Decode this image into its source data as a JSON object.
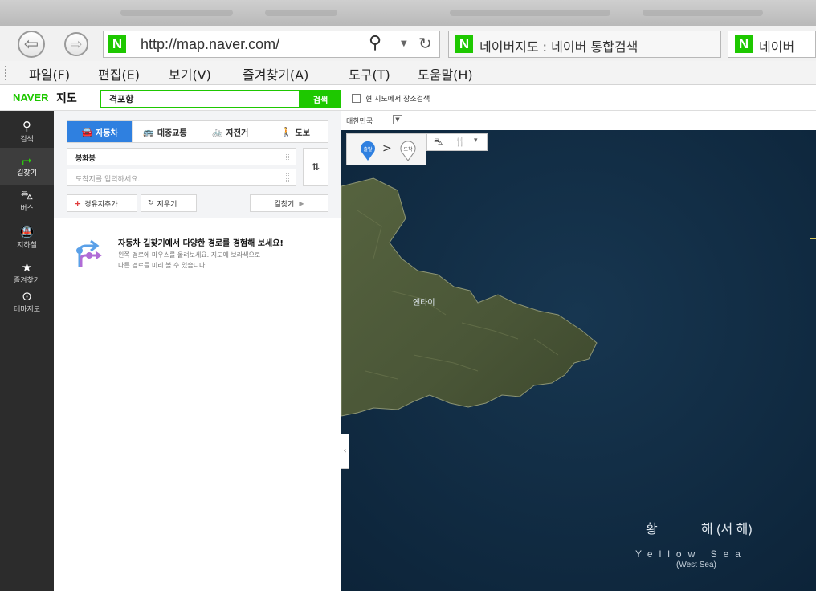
{
  "browser": {
    "url": "http://map.naver.com/",
    "logo_letter": "N",
    "tabs": [
      {
        "label": "네이버지도 : 네이버 통합검색"
      },
      {
        "label": "네이버"
      }
    ],
    "menu": [
      "파일(F)",
      "편집(E)",
      "보기(V)",
      "즐겨찾기(A)",
      "도구(T)",
      "도움말(H)"
    ]
  },
  "header": {
    "logo": "NAVER",
    "title": "지도",
    "search_value": "격포항",
    "search_button": "검색",
    "area_search_label": "현 지도에서 장소검색",
    "area_search_checked": false
  },
  "sidebar": {
    "items": [
      {
        "label": "검색",
        "icon": "search-icon",
        "active": false
      },
      {
        "label": "길찾기",
        "icon": "directions-icon",
        "active": true
      },
      {
        "label": "버스",
        "icon": "bus-icon",
        "active": false
      },
      {
        "label": "지하철",
        "icon": "subway-icon",
        "active": false
      },
      {
        "label": "즐겨찾기",
        "icon": "star-icon",
        "active": false
      },
      {
        "label": "테마지도",
        "icon": "pin-icon",
        "active": false
      }
    ]
  },
  "directions": {
    "modes": [
      {
        "label": "자동차",
        "icon": "car-icon",
        "active": true
      },
      {
        "label": "대중교통",
        "icon": "bus-icon",
        "active": false
      },
      {
        "label": "자전거",
        "icon": "bicycle-icon",
        "active": false
      },
      {
        "label": "도보",
        "icon": "walk-icon",
        "active": false
      }
    ],
    "start_value": "봉화봉",
    "destination_placeholder": "도착지를 입력하세요.",
    "add_waypoint_label": "경유지추가",
    "clear_label": "지우기",
    "find_route_label": "길찾기"
  },
  "promo": {
    "title": "자동차 길찾기에서 다양한 경로를 경험해 보세요!",
    "desc_line1": "왼쪽 경로에 마우스를 올려보세요. 지도에 보라색으로",
    "desc_line2": "다른 경로를 미리 볼 수 있습니다."
  },
  "map": {
    "region": "대한민국",
    "start_pin_label": "출발",
    "end_pin_label": "도착",
    "flow_arrow": ">",
    "labels": {
      "city": "옌타이",
      "sea_korean_1": "황",
      "sea_korean_2": "해 (서 해)",
      "sea_english": "Yellow Sea",
      "sea_english_sub": "(West Sea)"
    },
    "colors": {
      "sea": "#0e2a40",
      "land": "#4d5a3a"
    }
  },
  "colors": {
    "naver_green": "#1ec800",
    "active_blue": "#2f80e0",
    "sidebar_bg": "#2c2c2c"
  }
}
